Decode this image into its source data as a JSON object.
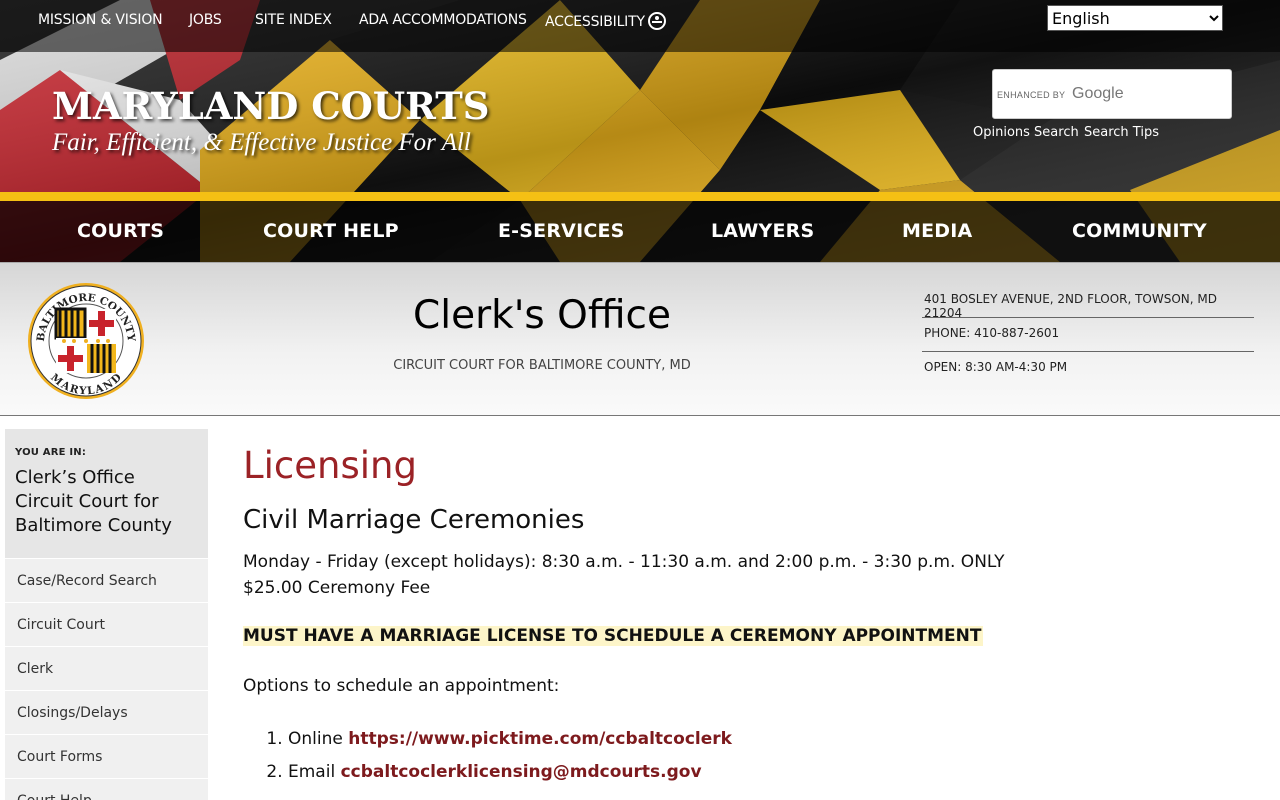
{
  "utility_nav": {
    "items": [
      "MISSION & VISION",
      "JOBS",
      "SITE INDEX",
      "ADA ACCOMMODATIONS",
      "ACCESSIBILITY"
    ]
  },
  "language": {
    "selected": "English"
  },
  "brand": {
    "title": "MARYLAND COURTS",
    "tagline": "Fair, Efficient, & Effective Justice For All"
  },
  "search": {
    "enhanced_label": "ENHANCED BY",
    "provider": "Google",
    "opinions_link": "Opinions Search",
    "tips_link": "Search Tips"
  },
  "main_nav": {
    "items": [
      "COURTS",
      "COURT HELP",
      "E-SERVICES",
      "LAWYERS",
      "MEDIA",
      "COMMUNITY"
    ]
  },
  "office": {
    "title": "Clerk's Office",
    "subtitle": "CIRCUIT COURT FOR BALTIMORE COUNTY, MD",
    "address": "401 BOSLEY AVENUE, 2ND FLOOR, TOWSON, MD 21204",
    "phone": "PHONE: 410-887-2601",
    "hours": "OPEN: 8:30 AM-4:30 PM",
    "seal_top_text": "BALTIMORE COUNTY",
    "seal_bottom_text": "MARYLAND"
  },
  "sidebar": {
    "you_are_in_label": "YOU ARE IN:",
    "location_line1": "Clerk’s Office",
    "location_line2": "Circuit Court for",
    "location_line3": "Baltimore County",
    "items": [
      "Case/Record Search",
      "Circuit Court",
      "Clerk",
      "Closings/Delays",
      "Court Forms",
      "Court Help"
    ]
  },
  "content": {
    "page_title": "Licensing",
    "section_title": "Civil Marriage Ceremonies",
    "hours_line": "Monday - Friday (except holidays): 8:30 a.m. - 11:30 a.m. and 2:00 p.m. - 3:30 p.m. ONLY",
    "fee_line": "$25.00 Ceremony Fee",
    "notice": "MUST HAVE A MARRIAGE LICENSE TO SCHEDULE A CEREMONY APPOINTMENT",
    "options_intro": "Options to schedule an appointment:",
    "options": [
      {
        "label": "Online",
        "link": "https://www.picktime.com/ccbaltcoclerk"
      },
      {
        "label": "Email",
        "link": "ccbaltcoclerklicensing@mdcourts.gov"
      }
    ]
  },
  "colors": {
    "accent_red": "#9b2226",
    "link_red": "#7d1a1d",
    "gold": "#f5c014",
    "notice_bg": "#fdf5c9"
  }
}
